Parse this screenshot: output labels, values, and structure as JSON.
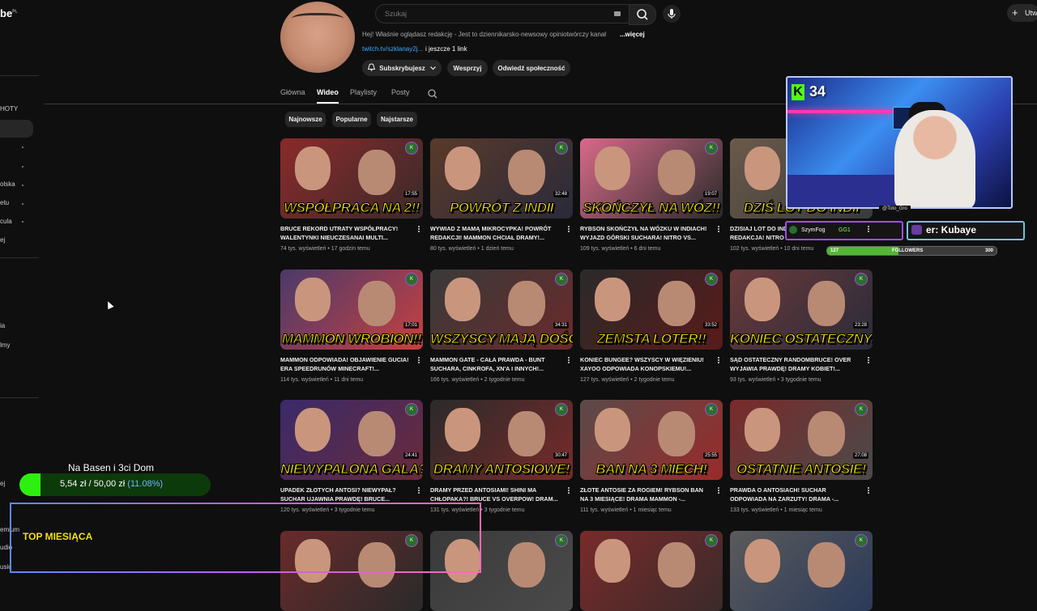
{
  "app": {
    "logo_text": "be",
    "logo_sup": "PL"
  },
  "sidebar": {
    "fragments": [
      "HOTY",
      "olska",
      "etu",
      "cula",
      "ej",
      "ia",
      "lmy",
      "ej",
      "emium",
      "udio",
      "usic"
    ]
  },
  "topbar": {
    "search_placeholder": "Szukaj",
    "create_label": "Utw"
  },
  "channel": {
    "description": "Hej! Właśnie oglądasz redakcję - Jest to dziennikarsko-newsowy opiniotwórczy kanał",
    "more_label": "...więcej",
    "link": "twitch.tv/szklanay2j...",
    "link_more": "i jeszcze 1 link",
    "subscribed_label": "Subskrybujesz",
    "support_label": "Wesprzyj",
    "community_label": "Odwiedź społeczność"
  },
  "tabs": [
    {
      "label": "Główna"
    },
    {
      "label": "Wideo",
      "active": true
    },
    {
      "label": "Playlisty"
    },
    {
      "label": "Posty"
    }
  ],
  "chips": [
    "Najnowsze",
    "Popularne",
    "Najstarsze"
  ],
  "videos": [
    {
      "caption": "WSPÓŁPRACA NA 2!!",
      "duration": "17:55",
      "title": "BRUCE REKORD UTRATY WSPÓŁPRACY! WALENTYNKI NIEUCZESANAI MULTI...",
      "views": "74 tys. wyświetleń",
      "age": "17 godzin temu",
      "c1": "#8a2a2a",
      "c2": "#3a2a2a"
    },
    {
      "caption": "POWRÓT Z INDII",
      "duration": "32:48",
      "title": "WYWIAD Z MAMĄ MIKROCYPKA! POWRÓT REDAKCJI! MAMMON CHCIAŁ DRAMY!...",
      "views": "80 tys. wyświetleń",
      "age": "1 dzień temu",
      "c1": "#5a3a2a",
      "c2": "#2a2a3a"
    },
    {
      "caption": "SKOŃCZYŁ NA WÓZ!!",
      "duration": "19:07",
      "title": "RYBSON SKOŃCZYŁ NA WÓZKU W INDIACH! WYJAZD GÓRSKI SUCHARA! NITRO vs...",
      "views": "109 tys. wyświetleń",
      "age": "6 dni temu",
      "c1": "#d86a8a",
      "c2": "#2a2a2a"
    },
    {
      "caption": "DZIŚ LOT DO INDII",
      "duration": "22:10",
      "title": "DZISIAJ LOT DO INDII! MAMMON DRAMA REDAKCJA! NITRO ZGADAŁ MIKROCYPE...",
      "views": "102 tys. wyświetleń",
      "age": "10 dni temu",
      "c1": "#6a5a4a",
      "c2": "#3a3a3a"
    },
    {
      "caption": "MAMMON WROBION!!",
      "duration": "17:01",
      "title": "MAMMON ODPOWIADA! OBJAWIENIE GUCIA! ERA SPEEDRUNÓW MINECRAFT!...",
      "views": "114 tys. wyświetleń",
      "age": "11 dni temu",
      "c1": "#4a3a6a",
      "c2": "#c84040"
    },
    {
      "caption": "WSZYSCY MAJĄ DOŚĆ",
      "duration": "34:31",
      "title": "MAMMON GATE - CAŁA PRAWDA - BUNT SUCHARA, CINKROFA, XN'a I INNYCH!...",
      "views": "166 tys. wyświetleń",
      "age": "2 tygodnie temu",
      "c1": "#3a3a3a",
      "c2": "#6a2a2a"
    },
    {
      "caption": "ZEMSTA LOTER!!",
      "duration": "33:52",
      "title": "KONIEC BUNGEE? WSZYSCY W WIĘZIENIU! XAYOO ODPOWIADA KONOPSKIEMU!...",
      "views": "127 tys. wyświetleń",
      "age": "2 tygodnie temu",
      "c1": "#2a2a2a",
      "c2": "#5a1a1a"
    },
    {
      "caption": "KONIEC OSTATECZNY!",
      "duration": "23:28",
      "title": "SĄD OSTATECZNY RANDOMBRUCE! OVER WYJAWIA PRAWDĘ! DRAMY KOBIET!...",
      "views": "93 tys. wyświetleń",
      "age": "3 tygodnie temu",
      "c1": "#6a3a3a",
      "c2": "#2a2a3a"
    },
    {
      "caption": "NIEWYPALONA GALA?",
      "duration": "24:41",
      "title": "UPADEK ZŁOTYCH ANTOSI? NIEWYPAŁ? SUCHAR UJAWNIA PRAWDĘ! BRUCE...",
      "views": "120 tys. wyświetleń",
      "age": "3 tygodnie temu",
      "c1": "#3a2a6a",
      "c2": "#6a2a3a"
    },
    {
      "caption": "DRAMY ANTOSIOWE!",
      "duration": "30:47",
      "title": "DRAMY PRZED ANTOSIAMI! SHINI MA CHŁOPAKA?! BRUCE vs OVERPOW! DRAM...",
      "views": "131 tys. wyświetleń",
      "age": "3 tygodnie temu",
      "c1": "#2a2a2a",
      "c2": "#7a2a2a"
    },
    {
      "caption": "BAN NA 3 MIECH!",
      "duration": "25:55",
      "title": "ZŁOTE ANTOSIE ZA ROGIEM! RYBSON BAN NA 3 MIESIĄCE! DRAMA MAMMON -...",
      "views": "111 tys. wyświetleń",
      "age": "1 miesiąc temu",
      "c1": "#5a4a4a",
      "c2": "#9a2a2a"
    },
    {
      "caption": "OSTATNIE ANTOSIE!",
      "duration": "27:08",
      "title": "PRAWDA O ANTOSIACH! SUCHAR ODPOWIADA NA ZARZUTY! DRAMA -...",
      "views": "133 tys. wyświetleń",
      "age": "1 miesiąc temu",
      "c1": "#7a2a2a",
      "c2": "#4a4a4a"
    },
    {
      "caption": "",
      "duration": "",
      "title": "",
      "views": "",
      "age": "",
      "c1": "#6a2a2a",
      "c2": "#2a2a2a"
    },
    {
      "caption": "",
      "duration": "",
      "title": "",
      "views": "",
      "age": "",
      "c1": "#3a3a3a",
      "c2": "#4a4a4a"
    },
    {
      "caption": "",
      "duration": "",
      "title": "",
      "views": "",
      "age": "",
      "c1": "#7a2a2a",
      "c2": "#3a2a2a"
    },
    {
      "caption": "",
      "duration": "",
      "title": "",
      "views": "",
      "age": "",
      "c1": "#5a5a5a",
      "c2": "#2a3a5a"
    }
  ],
  "stream": {
    "viewer_count": "34",
    "cam_handle": "@Toto_Gro",
    "chat_user": "SzymFog",
    "chat_msg": "GG1",
    "sub_alert": "er: Kubaye",
    "followers": {
      "label": "FOLLOWERS",
      "current": "127",
      "goal": "300",
      "progress": 0.42
    },
    "goal": {
      "title": "Na Basen i 3ci Dom",
      "amount": "5,54 zł",
      "sep": "/",
      "target": "50,00 zł",
      "percent": "(11.08%)",
      "progress": 0.1108
    },
    "top_label": "TOP MIESIĄCA"
  },
  "colors": {
    "accent_yellow": "#f5e400",
    "kick_green": "#53fc18",
    "link_blue": "#3ea6ff"
  }
}
